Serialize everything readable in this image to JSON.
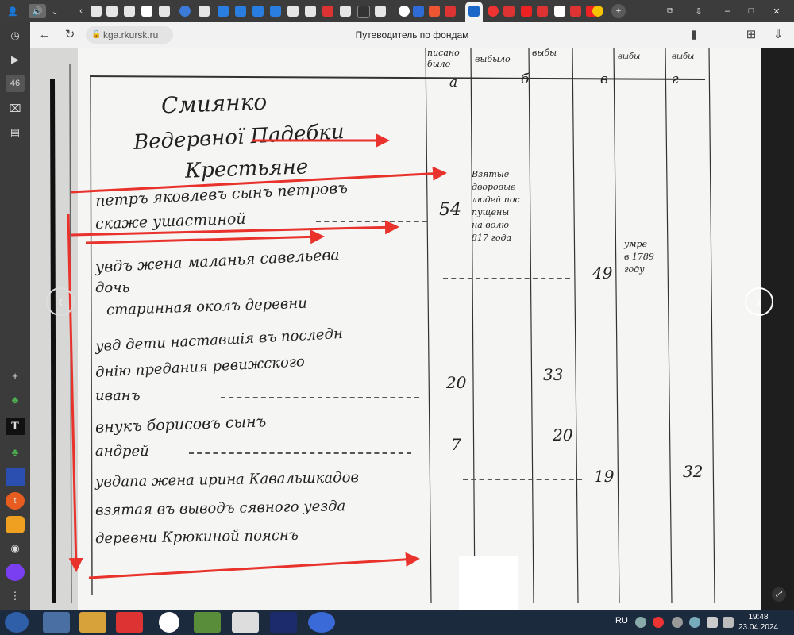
{
  "browser": {
    "tab_counter": "46",
    "url": "kga.rkursk.ru",
    "page_title": "Путеводитель по фондам"
  },
  "document": {
    "column_letters": [
      "а",
      "б",
      "в",
      "г"
    ],
    "title_lines": [
      "Смиянко",
      "Ведервної Падебки",
      "Крестьяне"
    ],
    "left_rows": [
      "петръ яковлевъ сынъ петровъ",
      "скаже ушастиной",
      "увдъ жена маланья савельева",
      "дочь",
      "старинная околъ деревни",
      "увд дети наставшія въ последн",
      "днію предания ревижского",
      "иванъ",
      "внукъ борисовъ сынъ",
      "андрей",
      "увдапа жена ирина Кавальшкадов",
      "взятая въ выводъ сявного уезда",
      "деревни Крюкиной пояснъ"
    ],
    "numbers": {
      "row1": "54",
      "row2": "49",
      "row3a": "20",
      "row3b": "33",
      "row4a": "7",
      "row4b": "20",
      "row5a": "19",
      "row5b": "32"
    },
    "notes": {
      "note1": [
        "Взятые",
        "дворовые",
        "людей пос",
        "пущены",
        "на волю",
        "817 года"
      ],
      "note2": [
        "умре",
        "в 1789",
        "году"
      ]
    }
  },
  "taskbar": {
    "lang": "RU",
    "time": "19:48",
    "date": "23.04.2024"
  },
  "colors": {
    "arrow_red": "#e8322b",
    "tab_strip": "#3c3c3c",
    "taskbar": "#1c2a3e"
  }
}
